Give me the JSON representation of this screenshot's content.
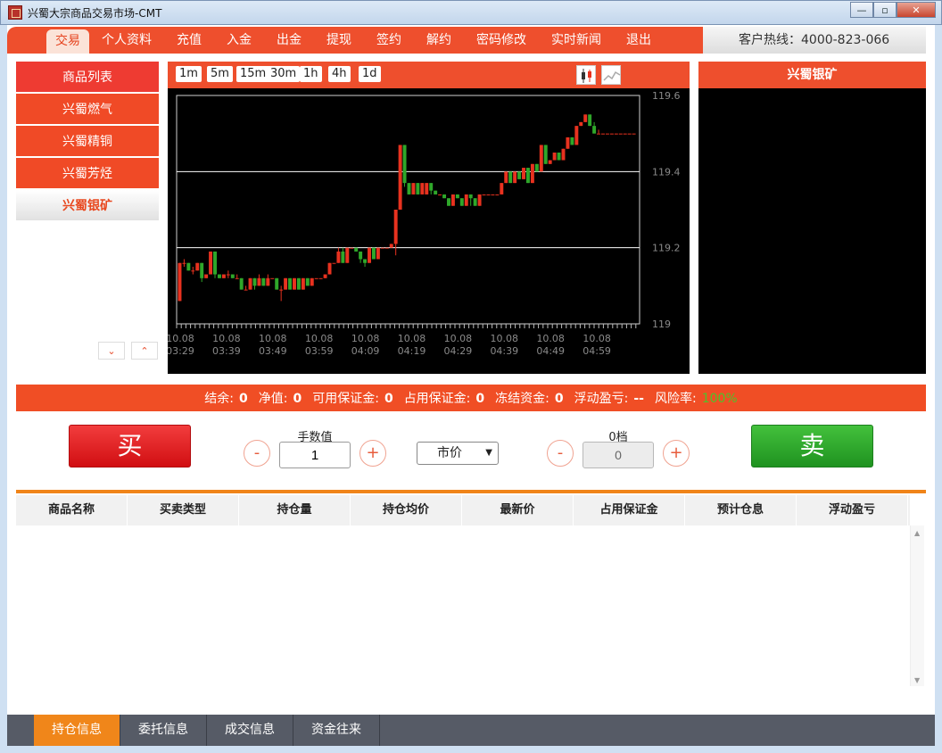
{
  "window": {
    "title": "兴蜀大宗商品交易市场-CMT",
    "controls": [
      "—",
      "▫",
      "✕"
    ]
  },
  "nav": {
    "items": [
      "交易",
      "个人资料",
      "充值",
      "入金",
      "出金",
      "提现",
      "签约",
      "解约",
      "密码修改",
      "实时新闻",
      "退出"
    ],
    "active_index": 0,
    "hotline_label": "客户热线：",
    "hotline_number": "4000-823-066"
  },
  "products": {
    "header": "商品列表",
    "items": [
      "兴蜀燃气",
      "兴蜀精铜",
      "兴蜀芳烃",
      "兴蜀银矿"
    ],
    "selected_index": 3,
    "scroll_down": "⌄",
    "scroll_up": "⌃"
  },
  "chart_toolbar": {
    "timeframes": [
      "1m",
      "5m",
      "15m",
      "30m",
      "1h",
      "4h",
      "1d"
    ],
    "tools": [
      "candlestick-icon",
      "line-chart-icon"
    ]
  },
  "chart_data": {
    "type": "candlestick",
    "y_ticks": [
      "119.6",
      "119.4",
      "119.2",
      "119"
    ],
    "ylim": [
      119.0,
      119.6
    ],
    "gridlines": [
      119.2,
      119.4
    ],
    "x_ticks": [
      {
        "date": "10.08",
        "time": "03:29"
      },
      {
        "date": "10.08",
        "time": "03:39"
      },
      {
        "date": "10.08",
        "time": "03:49"
      },
      {
        "date": "10.08",
        "time": "03:59"
      },
      {
        "date": "10.08",
        "time": "04:09"
      },
      {
        "date": "10.08",
        "time": "04:19"
      },
      {
        "date": "10.08",
        "time": "04:29"
      },
      {
        "date": "10.08",
        "time": "04:39"
      },
      {
        "date": "10.08",
        "time": "04:49"
      },
      {
        "date": "10.08",
        "time": "04:59"
      }
    ],
    "colors": {
      "up": "#e8321f",
      "down": "#2fa72a",
      "bg": "#000000",
      "grid": "#ffffff",
      "axis_text": "#8a8a8a"
    },
    "candles": [
      [
        119.06,
        119.16,
        119.16,
        119.06
      ],
      [
        119.16,
        119.16,
        119.17,
        119.15
      ],
      [
        119.16,
        119.14,
        119.16,
        119.14
      ],
      [
        119.14,
        119.14,
        119.15,
        119.13
      ],
      [
        119.14,
        119.16,
        119.16,
        119.14
      ],
      [
        119.16,
        119.12,
        119.16,
        119.11
      ],
      [
        119.12,
        119.13,
        119.13,
        119.12
      ],
      [
        119.13,
        119.19,
        119.19,
        119.13
      ],
      [
        119.19,
        119.13,
        119.19,
        119.12
      ],
      [
        119.13,
        119.12,
        119.13,
        119.12
      ],
      [
        119.12,
        119.13,
        119.13,
        119.12
      ],
      [
        119.13,
        119.13,
        119.14,
        119.12
      ],
      [
        119.13,
        119.12,
        119.13,
        119.12
      ],
      [
        119.12,
        119.12,
        119.13,
        119.12
      ],
      [
        119.12,
        119.09,
        119.12,
        119.09
      ],
      [
        119.09,
        119.09,
        119.1,
        119.09
      ],
      [
        119.09,
        119.12,
        119.12,
        119.09
      ],
      [
        119.12,
        119.1,
        119.12,
        119.09
      ],
      [
        119.1,
        119.12,
        119.13,
        119.1
      ],
      [
        119.12,
        119.1,
        119.12,
        119.1
      ],
      [
        119.1,
        119.12,
        119.13,
        119.1
      ],
      [
        119.12,
        119.12,
        119.12,
        119.12
      ],
      [
        119.12,
        119.09,
        119.12,
        119.09
      ],
      [
        119.09,
        119.09,
        119.1,
        119.06
      ],
      [
        119.09,
        119.12,
        119.12,
        119.09
      ],
      [
        119.12,
        119.09,
        119.12,
        119.09
      ],
      [
        119.09,
        119.12,
        119.12,
        119.09
      ],
      [
        119.12,
        119.09,
        119.12,
        119.09
      ],
      [
        119.09,
        119.12,
        119.12,
        119.09
      ],
      [
        119.12,
        119.1,
        119.12,
        119.1
      ],
      [
        119.1,
        119.12,
        119.12,
        119.1
      ],
      [
        119.12,
        119.12,
        119.12,
        119.12
      ],
      [
        119.12,
        119.12,
        119.12,
        119.12
      ],
      [
        119.12,
        119.13,
        119.13,
        119.12
      ],
      [
        119.13,
        119.16,
        119.16,
        119.13
      ],
      [
        119.16,
        119.16,
        119.16,
        119.16
      ],
      [
        119.16,
        119.19,
        119.2,
        119.16
      ],
      [
        119.19,
        119.16,
        119.2,
        119.16
      ],
      [
        119.16,
        119.2,
        119.2,
        119.16
      ],
      [
        119.2,
        119.2,
        119.2,
        119.2
      ],
      [
        119.2,
        119.19,
        119.2,
        119.19
      ],
      [
        119.19,
        119.17,
        119.19,
        119.16
      ],
      [
        119.17,
        119.16,
        119.17,
        119.15
      ],
      [
        119.16,
        119.2,
        119.2,
        119.16
      ],
      [
        119.2,
        119.17,
        119.2,
        119.17
      ],
      [
        119.17,
        119.2,
        119.2,
        119.17
      ],
      [
        119.2,
        119.2,
        119.2,
        119.2
      ],
      [
        119.2,
        119.2,
        119.2,
        119.2
      ],
      [
        119.2,
        119.21,
        119.21,
        119.2
      ],
      [
        119.21,
        119.3,
        119.3,
        119.18
      ],
      [
        119.3,
        119.47,
        119.47,
        119.3
      ],
      [
        119.47,
        119.37,
        119.47,
        119.36
      ],
      [
        119.37,
        119.34,
        119.37,
        119.34
      ],
      [
        119.34,
        119.37,
        119.37,
        119.34
      ],
      [
        119.37,
        119.34,
        119.37,
        119.34
      ],
      [
        119.34,
        119.37,
        119.37,
        119.34
      ],
      [
        119.34,
        119.37,
        119.37,
        119.34
      ],
      [
        119.37,
        119.35,
        119.37,
        119.34
      ],
      [
        119.35,
        119.34,
        119.35,
        119.34
      ],
      [
        119.34,
        119.34,
        119.34,
        119.34
      ],
      [
        119.34,
        119.33,
        119.34,
        119.33
      ],
      [
        119.33,
        119.31,
        119.33,
        119.31
      ],
      [
        119.31,
        119.34,
        119.34,
        119.31
      ],
      [
        119.34,
        119.33,
        119.34,
        119.33
      ],
      [
        119.33,
        119.31,
        119.33,
        119.31
      ],
      [
        119.31,
        119.34,
        119.34,
        119.31
      ],
      [
        119.34,
        119.33,
        119.34,
        119.31
      ],
      [
        119.33,
        119.31,
        119.33,
        119.31
      ],
      [
        119.31,
        119.34,
        119.34,
        119.31
      ],
      [
        119.34,
        119.34,
        119.34,
        119.34
      ],
      [
        119.34,
        119.34,
        119.34,
        119.34
      ],
      [
        119.34,
        119.34,
        119.34,
        119.34
      ],
      [
        119.34,
        119.34,
        119.34,
        119.34
      ],
      [
        119.34,
        119.37,
        119.37,
        119.34
      ],
      [
        119.37,
        119.4,
        119.4,
        119.37
      ],
      [
        119.4,
        119.37,
        119.4,
        119.37
      ],
      [
        119.37,
        119.4,
        119.4,
        119.37
      ],
      [
        119.4,
        119.38,
        119.4,
        119.38
      ],
      [
        119.38,
        119.41,
        119.41,
        119.38
      ],
      [
        119.41,
        119.37,
        119.41,
        119.37
      ],
      [
        119.37,
        119.42,
        119.42,
        119.37
      ],
      [
        119.42,
        119.4,
        119.42,
        119.4
      ],
      [
        119.4,
        119.47,
        119.47,
        119.4
      ],
      [
        119.47,
        119.42,
        119.47,
        119.42
      ],
      [
        119.42,
        119.43,
        119.43,
        119.42
      ],
      [
        119.43,
        119.45,
        119.45,
        119.43
      ],
      [
        119.45,
        119.43,
        119.45,
        119.43
      ],
      [
        119.43,
        119.46,
        119.46,
        119.43
      ],
      [
        119.46,
        119.49,
        119.49,
        119.46
      ],
      [
        119.49,
        119.47,
        119.49,
        119.47
      ],
      [
        119.47,
        119.52,
        119.52,
        119.47
      ],
      [
        119.52,
        119.53,
        119.53,
        119.52
      ],
      [
        119.53,
        119.55,
        119.55,
        119.53
      ],
      [
        119.55,
        119.52,
        119.55,
        119.52
      ],
      [
        119.52,
        119.5,
        119.53,
        119.5
      ],
      [
        119.5,
        119.5,
        119.51,
        119.5
      ],
      [
        119.5,
        119.5,
        119.5,
        119.5
      ],
      [
        119.5,
        119.5,
        119.5,
        119.5
      ],
      [
        119.5,
        119.5,
        119.5,
        119.5
      ],
      [
        119.5,
        119.5,
        119.5,
        119.5
      ],
      [
        119.5,
        119.5,
        119.5,
        119.5
      ],
      [
        119.5,
        119.5,
        119.5,
        119.5
      ],
      [
        119.5,
        119.5,
        119.5,
        119.5
      ],
      [
        119.5,
        119.5,
        119.5,
        119.5
      ]
    ]
  },
  "side_panel": {
    "title": "兴蜀银矿"
  },
  "account": {
    "fields": [
      {
        "label": "结余:",
        "value": "0"
      },
      {
        "label": "净值:",
        "value": "0"
      },
      {
        "label": "可用保证金:",
        "value": "0"
      },
      {
        "label": "占用保证金:",
        "value": "0"
      },
      {
        "label": "冻结资金:",
        "value": "0"
      },
      {
        "label": "浮动盈亏:",
        "value": "--"
      },
      {
        "label": "风险率:",
        "value": "100%"
      }
    ]
  },
  "trade": {
    "buy_label": "买",
    "sell_label": "卖",
    "minus": "-",
    "plus": "+",
    "qty_label": "手数值",
    "qty_value": "1",
    "order_type": "市价",
    "select_arrow": "▼",
    "price_label": "0档",
    "price_value": "0"
  },
  "positions": {
    "columns": [
      "商品名称",
      "买卖类型",
      "持仓量",
      "持仓均价",
      "最新价",
      "占用保证金",
      "预计仓息",
      "浮动盈亏"
    ],
    "scroll_up": "▲",
    "scroll_down": "▼"
  },
  "bottom_tabs": {
    "items": [
      "持仓信息",
      "委托信息",
      "成交信息",
      "资金往来"
    ],
    "active_index": 0
  }
}
